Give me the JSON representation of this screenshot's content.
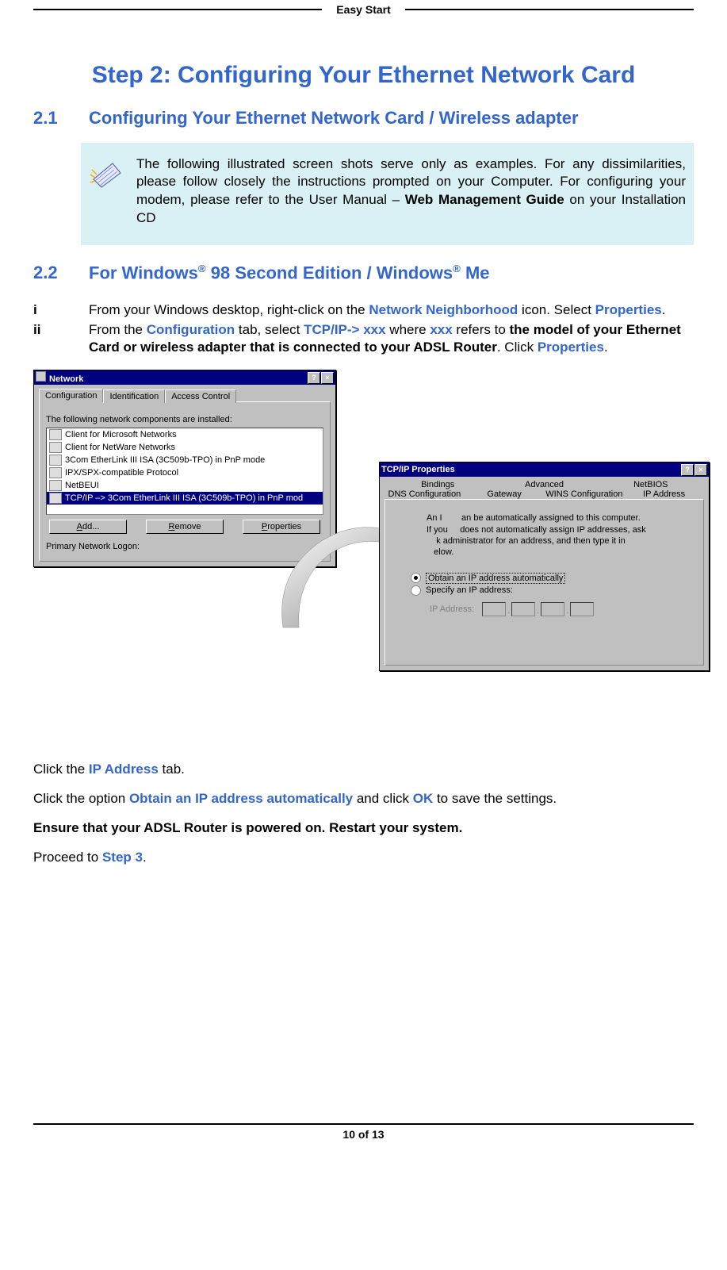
{
  "header": {
    "title": "Easy Start"
  },
  "step_title": "Step 2:  Configuring Your Ethernet Network Card",
  "section21": {
    "num": "2.1",
    "title": "Configuring Your Ethernet Network Card / Wireless adapter"
  },
  "note": {
    "text_pre": "The following illustrated screen shots serve only as examples.  For any dissimilarities, please follow closely the instructions prompted on your Computer. For configuring your modem, please refer to the User Manual – ",
    "bold": "Web Management Guide",
    "text_post": " on your Installation CD"
  },
  "section22": {
    "num": "2.2",
    "title_pre": "For Windows",
    "reg1": "®",
    "title_mid": " 98 Second Edition / Windows",
    "reg2": "®",
    "title_end": " Me"
  },
  "steps": [
    {
      "marker": "i",
      "parts": [
        {
          "t": "plain",
          "v": "From your Windows desktop, right-click on the "
        },
        {
          "t": "blue",
          "v": "Network Neighborhood"
        },
        {
          "t": "plain",
          "v": " icon.  Select "
        },
        {
          "t": "blue",
          "v": "Properties"
        },
        {
          "t": "plain",
          "v": "."
        }
      ]
    },
    {
      "marker": "ii",
      "parts": [
        {
          "t": "plain",
          "v": "From the "
        },
        {
          "t": "blue",
          "v": "Configuration"
        },
        {
          "t": "plain",
          "v": " tab, select "
        },
        {
          "t": "blue",
          "v": "TCP/IP-> xxx"
        },
        {
          "t": "plain",
          "v": " where "
        },
        {
          "t": "blue",
          "v": "xxx"
        },
        {
          "t": "plain",
          "v": " refers to "
        },
        {
          "t": "bold",
          "v": "the model of your Ethernet Card or wireless adapter that is connected to your ADSL Router"
        },
        {
          "t": "plain",
          "v": ". Click "
        },
        {
          "t": "blue",
          "v": "Properties"
        },
        {
          "t": "plain",
          "v": "."
        }
      ]
    }
  ],
  "network_dialog": {
    "title": "Network",
    "tabs": [
      "Configuration",
      "Identification",
      "Access Control"
    ],
    "active_tab": 0,
    "label": "The following network components are installed:",
    "items": [
      "Client for Microsoft Networks",
      "Client for NetWare Networks",
      "3Com EtherLink III ISA (3C509b-TPO) in PnP mode",
      "IPX/SPX-compatible Protocol",
      "NetBEUI",
      "TCP/IP –> 3Com EtherLink III ISA (3C509b-TPO) in PnP mod"
    ],
    "selected_item": 5,
    "buttons": {
      "add": "Add...",
      "remove": "Remove",
      "properties": "Properties"
    },
    "logon_label": "Primary Network Logon:"
  },
  "tcpip_dialog": {
    "title": "TCP/IP Properties",
    "tabs_row1": [
      "Bindings",
      "Advanced",
      "NetBIOS"
    ],
    "tabs_row2": [
      "DNS Configuration",
      "Gateway",
      "WINS Configuration",
      "IP Address"
    ],
    "active_tab": "IP Address",
    "desc_l1": "An I",
    "desc_l1b": "an be automatically assigned to this computer.",
    "desc_l2a": "If you",
    "desc_l2b": " does not automatically assign IP addresses, ask",
    "desc_l3a": "k administrator for an address, and then type it in",
    "desc_l4": "elow.",
    "radio_auto": "Obtain an IP address automatically",
    "radio_specify": "Specify an IP address:",
    "ip_label": "IP Address:"
  },
  "after": {
    "p1_pre": "Click the ",
    "p1_blue": "IP Address",
    "p1_post": " tab.",
    "p2_pre": "Click the option ",
    "p2_blue1": "Obtain an IP address automatically",
    "p2_mid": " and click ",
    "p2_blue2": "OK",
    "p2_post": " to save the settings.",
    "p3": "Ensure that your ADSL Router is powered on.  Restart your system.",
    "p4_pre": "Proceed to ",
    "p4_blue": "Step 3",
    "p4_post": "."
  },
  "footer": {
    "page": "10 of 13"
  }
}
